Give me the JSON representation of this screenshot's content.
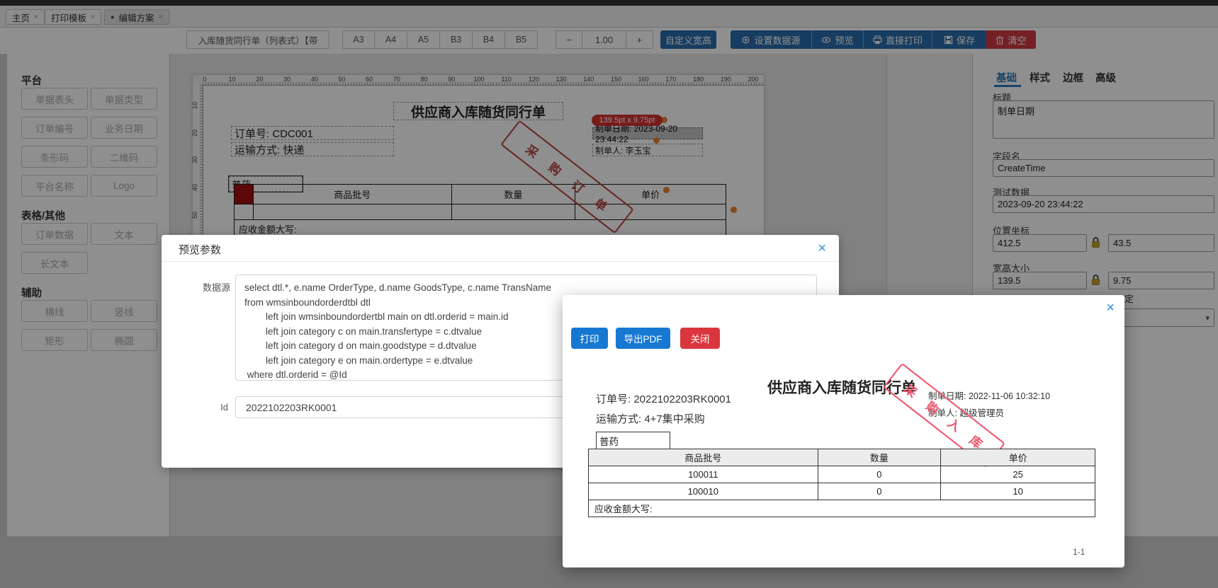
{
  "tabs": {
    "items": [
      {
        "label": "主页",
        "active": false
      },
      {
        "label": "打印模板",
        "active": false
      },
      {
        "label": "编辑方案",
        "active": true
      }
    ],
    "close_glyph": "×",
    "active_dot": "●"
  },
  "toolbar": {
    "template_name": "入库随货同行单（列表式）【带",
    "paper_sizes": [
      "A3",
      "A4",
      "A5",
      "B3",
      "B4",
      "B5"
    ],
    "zoom_out": "−",
    "zoom_value": "1.00",
    "zoom_in": "+",
    "custom_size": "自定义宽高",
    "set_datasource": "设置数据源",
    "preview": "预览",
    "direct_print": "直接打印",
    "save": "保存",
    "clear": "清空"
  },
  "sidebar": {
    "sections": [
      {
        "title": "平台",
        "buttons": [
          "单据表头",
          "单据类型",
          "订单编号",
          "业务日期",
          "条形码",
          "二维码",
          "平台名称",
          "Logo"
        ]
      },
      {
        "title": "表格/其他",
        "buttons": [
          "订单数据",
          "文本",
          "长文本"
        ]
      },
      {
        "title": "辅助",
        "buttons": [
          "横线",
          "竖线",
          "矩形",
          "椭圆"
        ]
      }
    ]
  },
  "canvas": {
    "h_ruler": [
      "0",
      "10",
      "20",
      "30",
      "40",
      "50",
      "60",
      "70",
      "80",
      "90",
      "100",
      "110",
      "120",
      "130",
      "140",
      "150",
      "160",
      "170",
      "180",
      "190",
      "200"
    ],
    "v_ruler": [
      "10",
      "20",
      "30",
      "40",
      "50"
    ],
    "size_tooltip": "139.5pt x 9.75pt",
    "stamp": "采购订单",
    "doc": {
      "title": "供应商入库随货同行单",
      "order_no": "订单号: CDC001",
      "transport": "运输方式: 快递",
      "create_date": "制单日期: 2023-09-20 23:44:22",
      "creator": "制单人: 李玉宝",
      "drug_type": "普药",
      "table": {
        "headers": [
          "商品批号",
          "数量",
          "单价"
        ],
        "footer": "应收金额大写:"
      }
    }
  },
  "inspector": {
    "tabs": [
      "基础",
      "样式",
      "边框",
      "高级"
    ],
    "title_label": "标题",
    "title_value": "制单日期",
    "field_label": "字段名",
    "field_value": "CreateTime",
    "test_label": "测试数据",
    "test_value": "2023-09-20 23:44:22",
    "pos_label": "位置坐标",
    "pos_x": "412.5",
    "pos_y": "43.5",
    "size_label": "宽高大小",
    "size_w": "139.5",
    "size_h": "9.75",
    "partial_label": "定",
    "select_chevron": "▾"
  },
  "preview_params_modal": {
    "title": "预览参数",
    "close_glyph": "×",
    "datasource_label": "数据源",
    "sql_lines": [
      "select dtl.*, e.name OrderType, d.name GoodsType, c.name TransName",
      "from wmsinboundorderdtbl dtl",
      "        left join wmsinboundordertbl main on dtl.orderid = main.id",
      "        left join category c on main.transfertype = c.dtvalue",
      "        left join category d on main.goodstype = d.dtvalue",
      "        left join category e on main.ordertype = e.dtvalue",
      " where dtl.orderid = @Id"
    ],
    "id_label": "Id",
    "id_value": "2022102203RK0001"
  },
  "preview_modal": {
    "print_btn": "打印",
    "export_pdf_btn": "导出PDF",
    "close_btn": "关闭",
    "close_glyph": "×",
    "doc": {
      "title": "供应商入库随货同行单",
      "order_no": "订单号: 2022102203RK0001",
      "transport": "运输方式: 4+7集中采购",
      "create_date": "制单日期: 2022-11-06 10:32:10",
      "creator": "制单人: 超级管理员",
      "drug_type": "普药",
      "stamp": "采购入库",
      "table": {
        "headers": [
          "商品批号",
          "数量",
          "单价"
        ],
        "rows": [
          [
            "100011",
            "0",
            "25"
          ],
          [
            "100010",
            "0",
            "10"
          ]
        ],
        "footer": "应收金额大写:"
      },
      "page_indicator": "1-1"
    }
  },
  "colors": {
    "primary_blue": "#2a6dab",
    "modal_blue": "#1778d2",
    "danger_red": "#cf3a40",
    "tooltip_red": "#d63031",
    "stamp_canvas": "#b0433f",
    "stamp_preview": "#f0516b",
    "handle_orange": "#e8833a",
    "table_marker_red": "#a50f0f",
    "active_tab_blue": "#2878be"
  }
}
